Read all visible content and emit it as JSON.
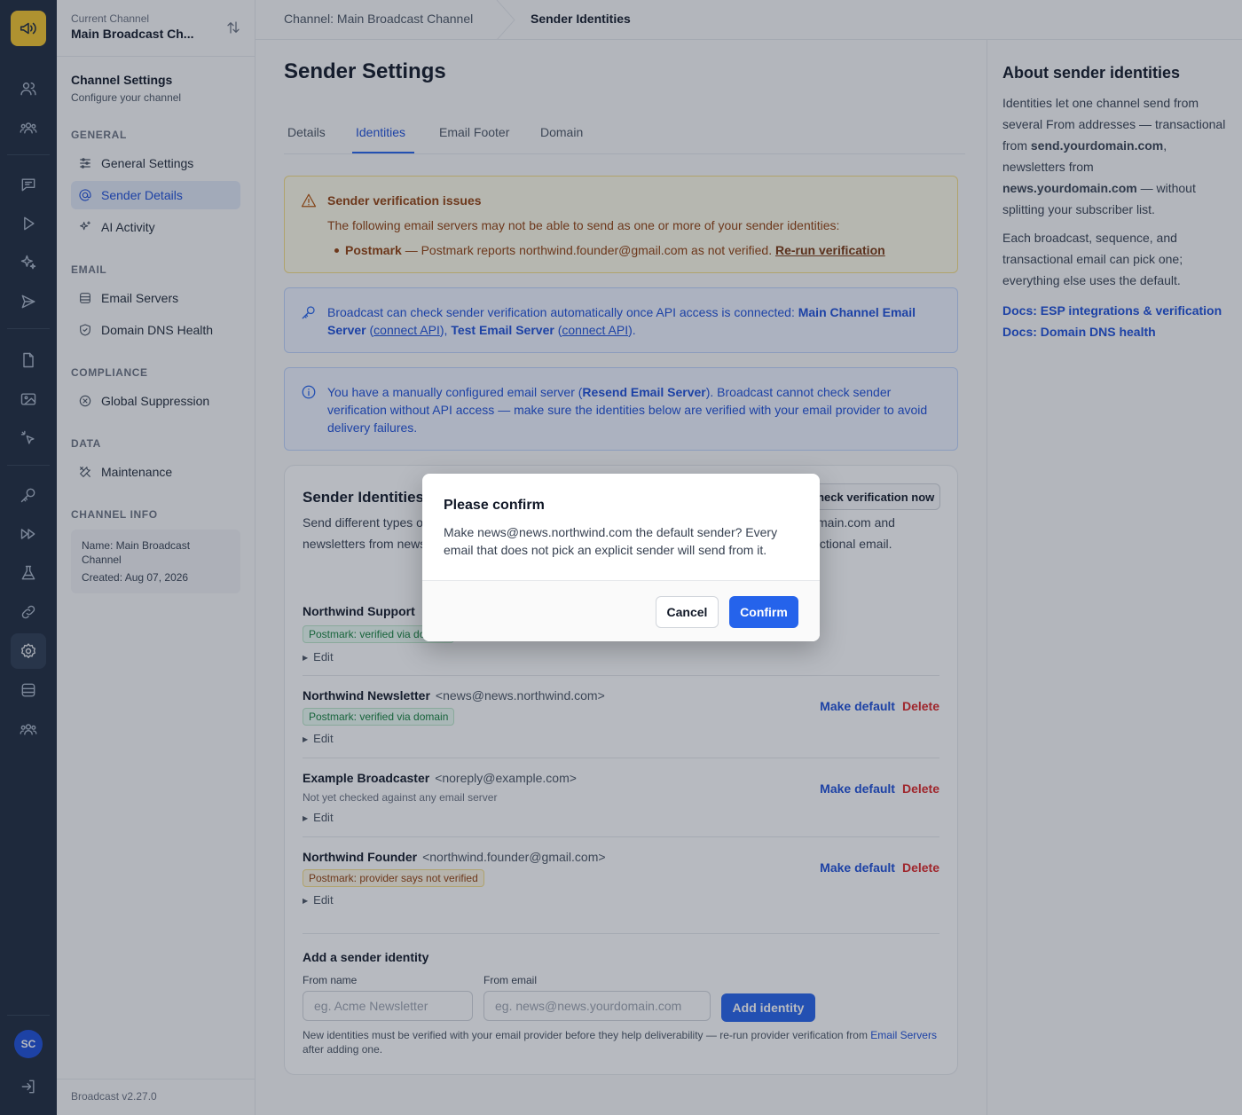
{
  "rail": {
    "icons": [
      "megaphone-icon",
      "users-icon",
      "group-icon",
      "chat-icon",
      "play-icon",
      "sparkles-icon",
      "send-icon",
      "file-icon",
      "image-icon",
      "pointer-icon",
      "key-icon",
      "forward-icon",
      "flask-icon",
      "link-icon",
      "gear-icon",
      "database-icon",
      "team-icon",
      "logout-icon"
    ],
    "avatar_initials": "SC"
  },
  "sidebar": {
    "current_channel_label": "Current Channel",
    "current_channel_name": "Main Broadcast Ch...",
    "heading": "Channel Settings",
    "subheading": "Configure your channel",
    "sections": {
      "general": "GENERAL",
      "email": "EMAIL",
      "compliance": "COMPLIANCE",
      "data": "DATA",
      "channel_info": "CHANNEL INFO"
    },
    "items": {
      "general_settings": "General Settings",
      "sender_details": "Sender Details",
      "ai_activity": "AI Activity",
      "email_servers": "Email Servers",
      "domain_dns_health": "Domain DNS Health",
      "global_suppression": "Global Suppression",
      "maintenance": "Maintenance"
    },
    "info": {
      "name": "Name: Main Broadcast Channel",
      "created": "Created: Aug 07, 2026"
    },
    "version": "Broadcast v2.27.0"
  },
  "breadcrumb": {
    "channel": "Channel: Main Broadcast Channel",
    "current": "Sender Identities"
  },
  "main": {
    "title": "Sender Settings",
    "tabs": [
      "Details",
      "Identities",
      "Email Footer",
      "Domain"
    ],
    "active_tab": "Identities",
    "warning": {
      "title": "Sender verification issues",
      "body": "The following email servers may not be able to send as one or more of your sender identities:",
      "item_server": "Postmark",
      "item_text": " — Postmark reports northwind.founder@gmail.com as not verified. ",
      "item_link": "Re-run verification"
    },
    "api_notice": {
      "prefix": "Broadcast can check sender verification automatically once API access is connected: ",
      "server1": "Main Channel Email Server",
      "link1": "connect API",
      "server2": "Test Email Server",
      "link2": "connect API"
    },
    "manual_notice": {
      "prefix": "You have a manually configured email server (",
      "server": "Resend Email Server",
      "suffix": "). Broadcast cannot check sender verification without API access — make sure the identities below are verified with your email provider to avoid delivery failures."
    },
    "card": {
      "title": "Sender Identities",
      "check_button": "Check verification now",
      "description": "Send different types of emails from different addresses — e.g. transactional from send.yourdomain.com and newsletters from news.yourdomain.com. Pick the sender per broadcast, sequence, and transactional email.",
      "identities": [
        {
          "name": "Northwind Support",
          "email": "",
          "badge": "Postmark: verified via domain",
          "badge_type": "ok",
          "note": "",
          "edit": "Edit",
          "make_default": "",
          "delete": ""
        },
        {
          "name": "Northwind Newsletter",
          "email": "<news@news.northwind.com>",
          "badge": "Postmark: verified via domain",
          "badge_type": "ok",
          "note": "",
          "edit": "Edit",
          "make_default": "Make default",
          "delete": "Delete"
        },
        {
          "name": "Example Broadcaster",
          "email": "<noreply@example.com>",
          "badge": "",
          "badge_type": "",
          "note": "Not yet checked against any email server",
          "edit": "Edit",
          "make_default": "Make default",
          "delete": "Delete"
        },
        {
          "name": "Northwind Founder",
          "email": "<northwind.founder@gmail.com>",
          "badge": "Postmark: provider says not verified",
          "badge_type": "bad",
          "note": "",
          "edit": "Edit",
          "make_default": "Make default",
          "delete": "Delete"
        }
      ],
      "add": {
        "title": "Add a sender identity",
        "from_name_label": "From name",
        "from_name_placeholder": "eg. Acme Newsletter",
        "from_email_label": "From email",
        "from_email_placeholder": "eg. news@news.yourdomain.com",
        "button": "Add identity",
        "note_prefix": "New identities must be verified with your email provider before they help deliverability — re-run provider verification from ",
        "note_link": "Email Servers",
        "note_suffix": " after adding one."
      }
    }
  },
  "right_panel": {
    "title": "About sender identities",
    "p1_a": "Identities let one channel send from several From addresses — transactional from ",
    "p1_b": "send.yourdomain.com",
    "p1_c": ", newsletters from ",
    "p1_d": "news.yourdomain.com",
    "p1_e": " — without splitting your subscriber list.",
    "p2": "Each broadcast, sequence, and transactional email can pick one; everything else uses the default.",
    "link1": "Docs: ESP integrations & verification",
    "link2": "Docs: Domain DNS health"
  },
  "dialog": {
    "title": "Please confirm",
    "message": "Make news@news.northwind.com the default sender? Every email that does not pick an explicit sender will send from it.",
    "cancel": "Cancel",
    "confirm": "Confirm"
  },
  "colors": {
    "accent": "#2563eb",
    "rail_bg": "#1e2a3d",
    "logo_bg": "#f3c42b",
    "danger": "#dc2626"
  }
}
